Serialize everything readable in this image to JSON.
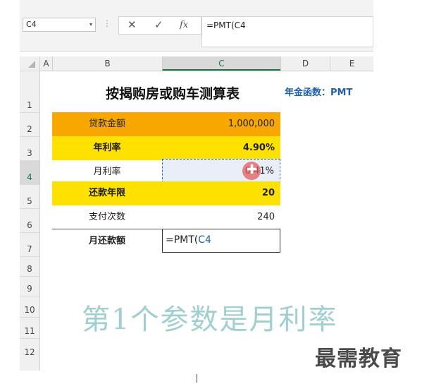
{
  "formula_bar": {
    "name_box": "C4",
    "cancel_icon": "✕",
    "enter_icon": "✓",
    "fx_label": "fx",
    "formula": "=PMT(C4"
  },
  "columns": [
    "A",
    "B",
    "C",
    "D",
    "E"
  ],
  "rows": [
    "1",
    "2",
    "3",
    "4",
    "5",
    "6",
    "7",
    "8",
    "9",
    "10",
    "11",
    "12"
  ],
  "sheet": {
    "title": "按揭购房或购车测算表",
    "pmt_note": "年金函数：PMT",
    "loan_amount_label": "贷款金额",
    "loan_amount_value": "1,000,000",
    "annual_rate_label": "年利率",
    "annual_rate_value": "4.90%",
    "monthly_rate_label": "月利率",
    "monthly_rate_value": "0.41%",
    "years_label": "还款年限",
    "years_value": "20",
    "payments_label": "支付次数",
    "payments_value": "240",
    "monthly_payment_label": "月还款额",
    "monthly_payment_prefix": "=PMT(",
    "monthly_payment_ref": "C4"
  },
  "caption": "第1个参数是月利率",
  "watermark": "最需教育",
  "colors": {
    "orange": "#f7a700",
    "yellow": "#ffe100",
    "selection_blue": "#2f67b8",
    "ref_blue": "#1f5fa8",
    "caption": "#9fcfd1"
  }
}
